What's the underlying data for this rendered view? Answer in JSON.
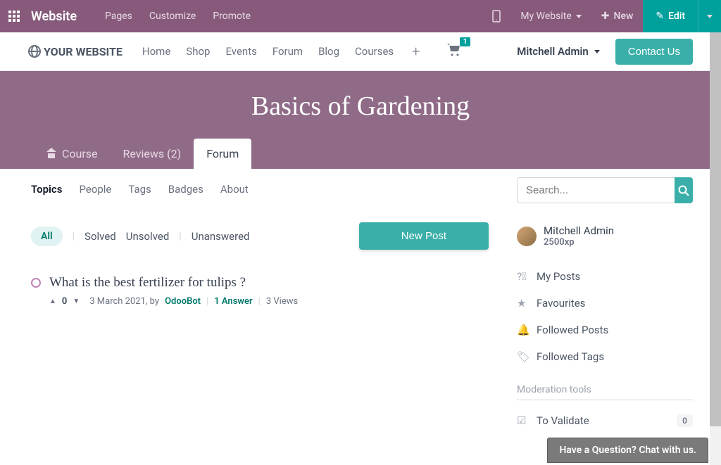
{
  "topbar": {
    "brand": "Website",
    "menu": [
      "Pages",
      "Customize",
      "Promote"
    ],
    "my_website": "My Website",
    "new": "New",
    "edit": "Edit"
  },
  "nav": {
    "logo": "YOUR WEBSITE",
    "links": [
      "Home",
      "Shop",
      "Events",
      "Forum",
      "Blog",
      "Courses"
    ],
    "cart_count": "1",
    "user": "Mitchell Admin",
    "contact": "Contact Us"
  },
  "hero": {
    "title": "Basics of Gardening",
    "tabs": {
      "course": "Course",
      "reviews": "Reviews (2)",
      "forum": "Forum"
    }
  },
  "subnav": [
    "Topics",
    "People",
    "Tags",
    "Badges",
    "About"
  ],
  "filters": {
    "all": "All",
    "solved": "Solved",
    "unsolved": "Unsolved",
    "unanswered": "Unanswered"
  },
  "new_post": "New Post",
  "search_placeholder": "Search...",
  "post": {
    "title": "What is the best fertilizer for tulips ?",
    "votes": "0",
    "date": "3 March 2021, by",
    "author": "OdooBot",
    "answers": "1 Answer",
    "views": "3 Views"
  },
  "sidebar": {
    "profile": {
      "name": "Mitchell Admin",
      "xp": "2500xp"
    },
    "links": {
      "my_posts": "My Posts",
      "favourites": "Favourites",
      "followed_posts": "Followed Posts",
      "followed_tags": "Followed Tags"
    },
    "mod_title": "Moderation tools",
    "to_validate": "To Validate",
    "to_validate_count": "0"
  },
  "chat": "Have a Question? Chat with us."
}
